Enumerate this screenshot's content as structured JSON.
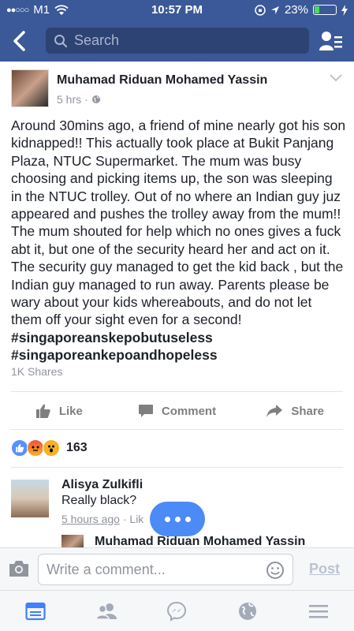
{
  "status_bar": {
    "signal": "●●○○○",
    "carrier": "M1",
    "time": "10:57 PM",
    "battery_percent": "23%",
    "battery_level": 0.23
  },
  "nav": {
    "search_placeholder": "Search"
  },
  "post": {
    "author": "Muhamad Riduan Mohamed Yassin",
    "timestamp": "5 hrs",
    "separator": "·",
    "body": "Around 30mins ago, a friend of mine nearly got his son kidnapped!! This actually took place at Bukit Panjang Plaza, NTUC Supermarket. The mum was busy choosing and picking items up, the son was sleeping in the NTUC trolley. Out of no where an Indian guy juz appeared and pushes  the trolley away from the mum!! The mum shouted for help which no ones gives a fuck abt it, but one of the security heard her and act on it. The security guy managed to get the kid back , but the Indian guy managed to run away. Parents please be wary about your kids whereabouts, and do not let them off your sight even for a second! ",
    "hashtag1": "#singaporeanskepobutuseless",
    "hashtag2": "#singaporeankepoandhopeless",
    "shares": "1K Shares",
    "actions": {
      "like": "Like",
      "comment": "Comment",
      "share": "Share"
    },
    "reaction_count": "163"
  },
  "comment": {
    "author": "Alisya Zulkifli",
    "text": "Really black?",
    "time": "5 hours ago",
    "separator": "·",
    "like_label": "Lik",
    "reply_author": "Muhamad Riduan Mohamed Yassin"
  },
  "composer": {
    "placeholder": "Write a comment...",
    "post_label": "Post"
  },
  "colors": {
    "brand": "#3b5998",
    "like": "#5890ff",
    "angry": "#f0523c",
    "wow": "#f7b125"
  },
  "icons": {
    "tabs": [
      "news-feed-icon",
      "friends-icon",
      "messenger-icon",
      "globe-icon",
      "menu-icon"
    ]
  }
}
